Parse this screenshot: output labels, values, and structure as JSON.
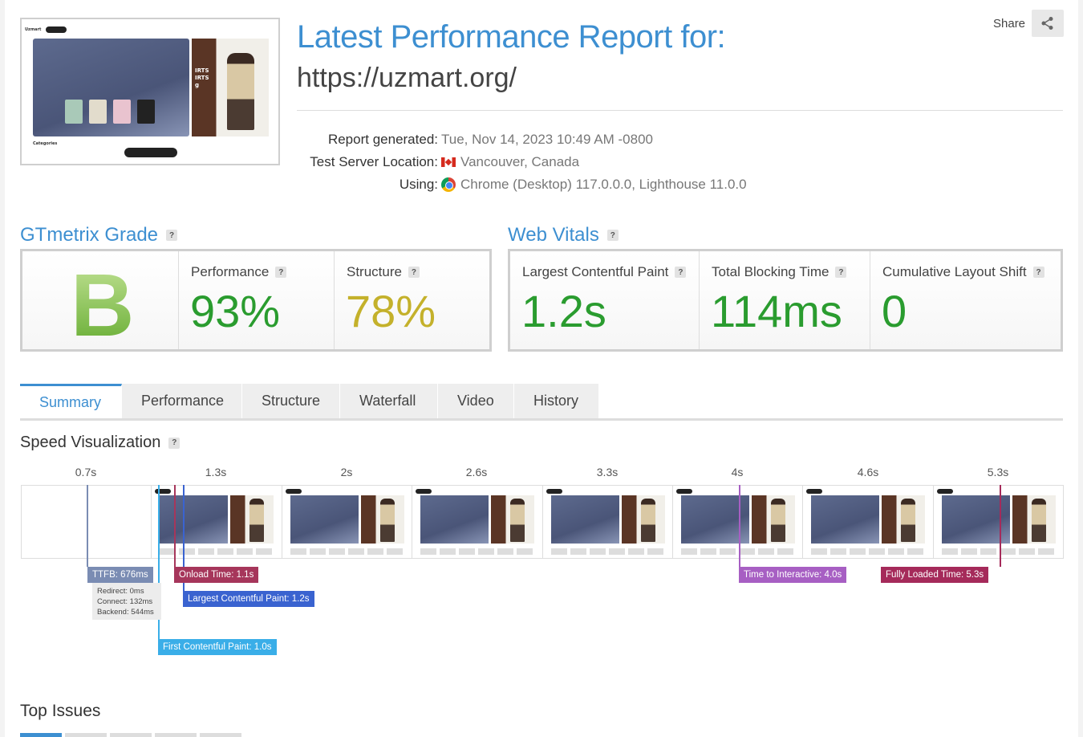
{
  "report": {
    "title": "Latest Performance Report for:",
    "url": "https://uzmart.org/",
    "share_label": "Share",
    "meta": [
      {
        "key": "Report generated:",
        "value": "Tue, Nov 14, 2023 10:49 AM -0800",
        "icon": null
      },
      {
        "key": "Test Server Location:",
        "value": "Vancouver, Canada",
        "icon": "canada-flag-icon"
      },
      {
        "key": "Using:",
        "value": "Chrome (Desktop) 117.0.0.0, Lighthouse 11.0.0",
        "icon": "chrome-icon"
      }
    ]
  },
  "thumbnail": {
    "logo": "Uzmart",
    "panel_text": "IRTS\nIRTS\ng",
    "categories": "Categories"
  },
  "grade": {
    "title": "GTmetrix Grade",
    "help": "?",
    "letter": "B",
    "performance_label": "Performance",
    "performance_value": "93%",
    "structure_label": "Structure",
    "structure_value": "78%",
    "colors": {
      "performance": "#2a9c2f",
      "structure": "#c4b12b"
    }
  },
  "vitals": {
    "title": "Web Vitals",
    "help": "?",
    "items": [
      {
        "label": "Largest Contentful Paint",
        "value": "1.2s"
      },
      {
        "label": "Total Blocking Time",
        "value": "114ms"
      },
      {
        "label": "Cumulative Layout Shift",
        "value": "0"
      }
    ],
    "color": "#2a9c2f"
  },
  "tabs": [
    "Summary",
    "Performance",
    "Structure",
    "Waterfall",
    "Video",
    "History"
  ],
  "active_tab": "Summary",
  "speed": {
    "title": "Speed Visualization",
    "help": "?",
    "ticks": [
      "0.7s",
      "1.3s",
      "2s",
      "2.6s",
      "3.3s",
      "4s",
      "4.6s",
      "5.3s"
    ],
    "markers": {
      "ttfb": "TTFB: 676ms",
      "onload": "Onload Time: 1.1s",
      "lcp": "Largest Contentful Paint: 1.2s",
      "fcp": "First Contentful Paint: 1.0s",
      "tti": "Time to Interactive: 4.0s",
      "fully": "Fully Loaded Time: 5.3s"
    },
    "ttfb_detail": [
      "Redirect: 0ms",
      "Connect: 132ms",
      "Backend: 544ms"
    ],
    "colors": {
      "ttfb": "#7a8cb3",
      "onload": "#a6365b",
      "lcp": "#3a63d0",
      "fcp": "#3aaee8",
      "tti": "#a75fc3",
      "fully": "#a52a5a"
    }
  },
  "top_issues": {
    "title": "Top Issues"
  }
}
